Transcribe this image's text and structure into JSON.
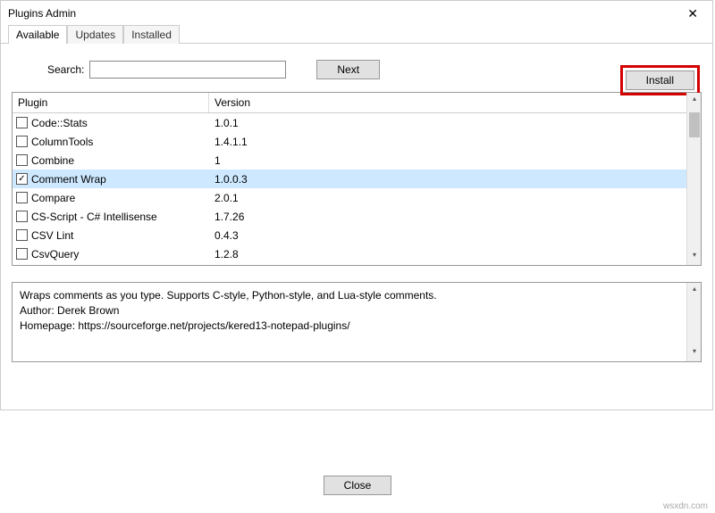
{
  "window": {
    "title": "Plugins Admin"
  },
  "tabs": {
    "available": "Available",
    "updates": "Updates",
    "installed": "Installed"
  },
  "search": {
    "label": "Search:",
    "value": "",
    "next": "Next"
  },
  "install": {
    "label": "Install"
  },
  "columns": {
    "plugin": "Plugin",
    "version": "Version"
  },
  "plugins": [
    {
      "name": "Code::Stats",
      "version": "1.0.1",
      "checked": false
    },
    {
      "name": "ColumnTools",
      "version": "1.4.1.1",
      "checked": false
    },
    {
      "name": "Combine",
      "version": "1",
      "checked": false
    },
    {
      "name": "Comment Wrap",
      "version": "1.0.0.3",
      "checked": true,
      "selected": true
    },
    {
      "name": "Compare",
      "version": "2.0.1",
      "checked": false
    },
    {
      "name": "CS-Script - C# Intellisense",
      "version": "1.7.26",
      "checked": false
    },
    {
      "name": "CSV Lint",
      "version": "0.4.3",
      "checked": false
    },
    {
      "name": "CsvQuery",
      "version": "1.2.8",
      "checked": false
    }
  ],
  "description": "Wraps comments as you type. Supports C-style, Python-style, and Lua-style comments.\nAuthor: Derek Brown\nHomepage: https://sourceforge.net/projects/kered13-notepad-plugins/",
  "close": "Close",
  "watermark": "wsxdn.com"
}
